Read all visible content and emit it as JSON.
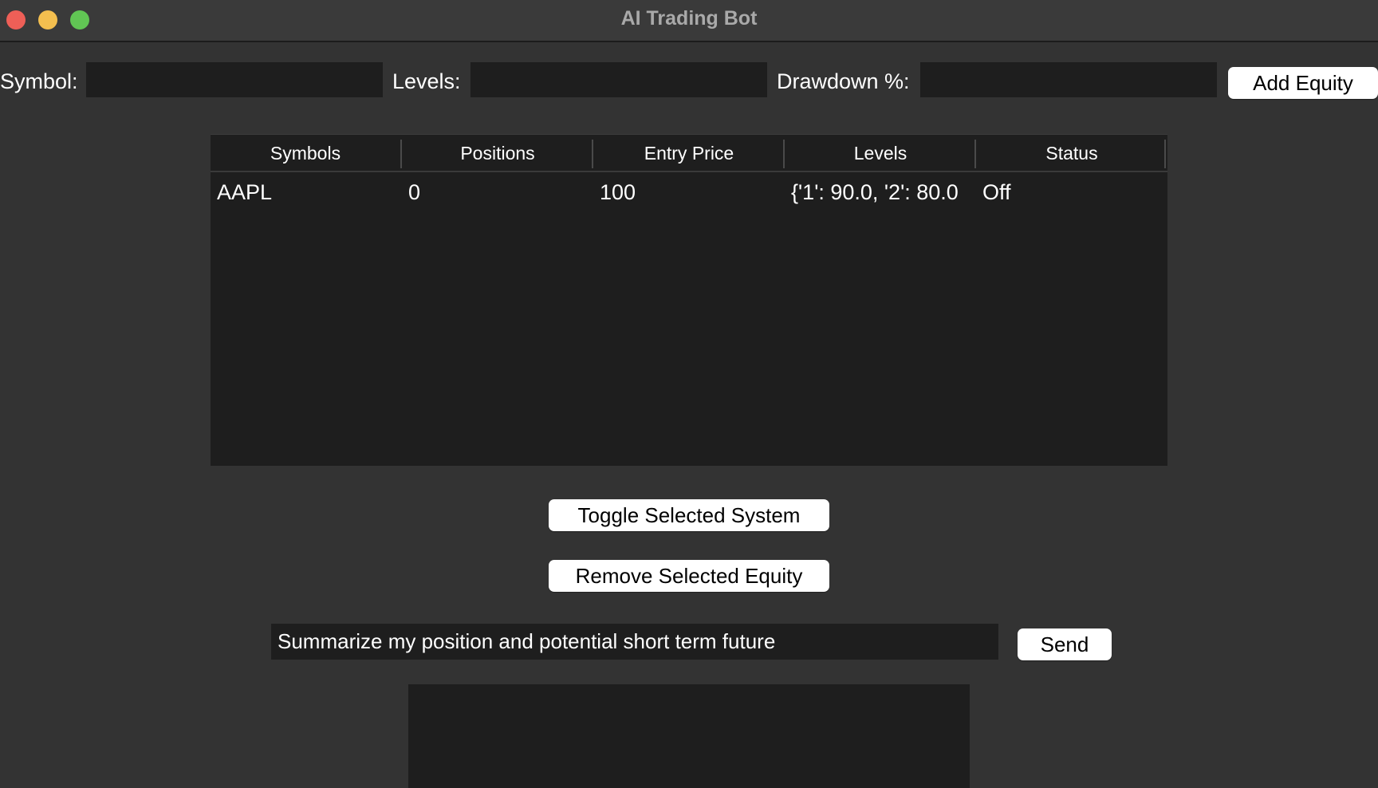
{
  "window": {
    "title": "AI Trading Bot"
  },
  "form": {
    "symbol_label": "Symbol:",
    "symbol_value": "",
    "levels_label": "Levels:",
    "levels_value": "",
    "drawdown_label": "Drawdown %:",
    "drawdown_value": "",
    "add_button": "Add Equity"
  },
  "table": {
    "columns": [
      "Symbols",
      "Positions",
      "Entry Price",
      "Levels",
      "Status"
    ],
    "rows": [
      [
        "AAPL",
        "0",
        "100",
        "{'1': 90.0, '2': 80.0",
        "Off"
      ]
    ]
  },
  "actions": {
    "toggle_button": "Toggle Selected System",
    "remove_button": "Remove Selected Equity"
  },
  "chat": {
    "input_value": "Summarize my position and potential short term future",
    "send_button": "Send",
    "output_text": ""
  },
  "colors": {
    "background": "#333333",
    "field": "#1e1e1e",
    "button": "#ffffff",
    "close": "#ee5f57",
    "minimize": "#f4bf4f",
    "maximize": "#61c554"
  }
}
